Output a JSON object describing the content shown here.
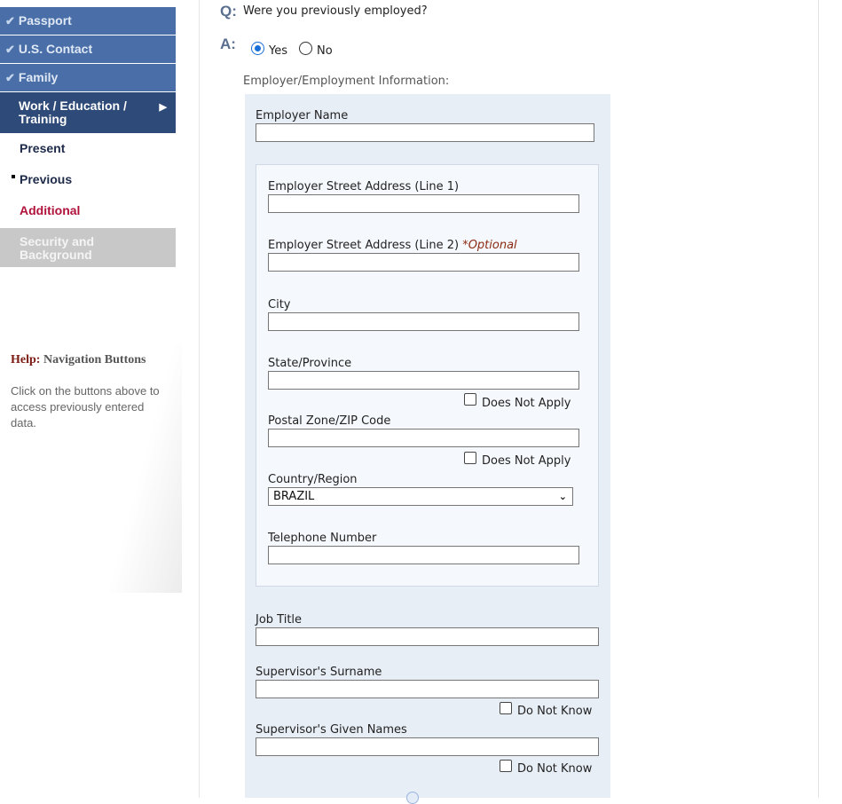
{
  "sidebar": {
    "completed": [
      {
        "label": "Passport"
      },
      {
        "label": "U.S. Contact"
      },
      {
        "label": "Family"
      }
    ],
    "active": {
      "label_line1": "Work / Education /",
      "label_line2": "Training"
    },
    "sub_items": {
      "present": "Present",
      "previous": "Previous",
      "additional": "Additional"
    },
    "disabled": {
      "label_line1": "Security and",
      "label_line2": "Background"
    },
    "help": {
      "title_strong": "Help:",
      "title_rest": "Navigation Buttons",
      "text": "Click on the buttons above to access previously entered data."
    }
  },
  "question": {
    "q_letter": "Q:",
    "text": "Were you previously employed?",
    "a_letter": "A:",
    "options": [
      "Yes",
      "No"
    ],
    "selected": "Yes"
  },
  "form": {
    "section_label": "Employer/Employment Information:",
    "employer_name": {
      "label": "Employer Name",
      "value": ""
    },
    "address_line1": {
      "label": "Employer Street Address (Line 1)",
      "value": ""
    },
    "address_line2": {
      "label": "Employer Street Address (Line 2)",
      "optional": "*Optional",
      "value": ""
    },
    "city": {
      "label": "City",
      "value": ""
    },
    "state": {
      "label": "State/Province",
      "value": "",
      "checkbox_label": "Does Not Apply"
    },
    "postal": {
      "label": "Postal Zone/ZIP Code",
      "value": "",
      "checkbox_label": "Does Not Apply"
    },
    "country": {
      "label": "Country/Region",
      "value": "BRAZIL"
    },
    "telephone": {
      "label": "Telephone Number",
      "value": ""
    },
    "job_title": {
      "label": "Job Title",
      "value": ""
    },
    "supervisor_surname": {
      "label": "Supervisor's Surname",
      "value": "",
      "checkbox_label": "Do Not Know"
    },
    "supervisor_given": {
      "label": "Supervisor's Given Names",
      "value": "",
      "checkbox_label": "Do Not Know"
    }
  },
  "colors": {
    "nav_completed": "#4a6fa8",
    "nav_active": "#2e4a78",
    "nav_disabled": "#c8c8c8",
    "additional_link": "#b0123b",
    "optional_text": "#8b2a12",
    "panel_bg": "#e8eef6"
  },
  "icons": {
    "completed": "checkmark-icon",
    "active_arrow": "triangle-right-icon",
    "select": "chevron-down-icon"
  }
}
